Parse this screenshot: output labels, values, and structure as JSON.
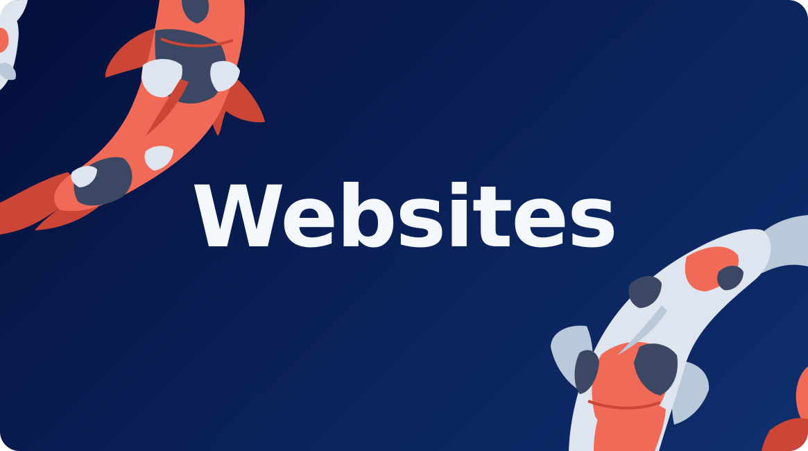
{
  "card": {
    "headline": "Websites",
    "colors": {
      "background_dark": "#040f3a",
      "background_light": "#0f2f6e",
      "headline": "#f4f7fb",
      "koi_red": "#f06a57",
      "koi_red_dark": "#cc4637",
      "koi_white": "#dfe5ef",
      "koi_pale_blue": "#b9c9d9",
      "koi_spot": "#3c4863"
    },
    "illustrations": [
      "koi-fish-top-left",
      "koi-fish-bottom-right"
    ]
  }
}
